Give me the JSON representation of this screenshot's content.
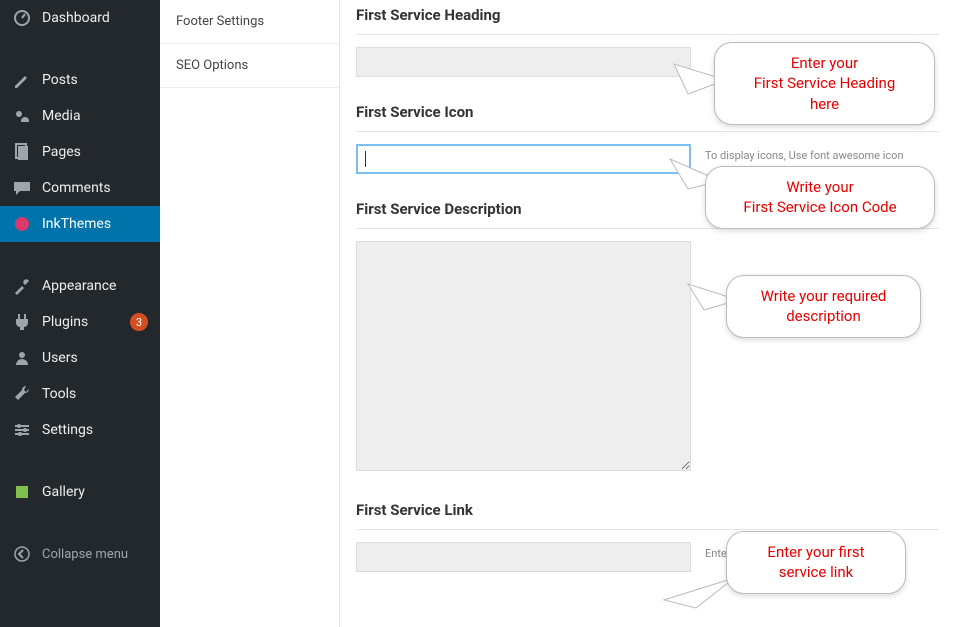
{
  "sidebar": {
    "items": [
      {
        "label": "Dashboard",
        "icon": "dashboard-icon"
      },
      {
        "label": "Posts",
        "icon": "posts-icon"
      },
      {
        "label": "Media",
        "icon": "media-icon"
      },
      {
        "label": "Pages",
        "icon": "pages-icon"
      },
      {
        "label": "Comments",
        "icon": "comments-icon"
      },
      {
        "label": "InkThemes",
        "icon": "inkthemes-icon",
        "active": true
      },
      {
        "label": "Appearance",
        "icon": "appearance-icon"
      },
      {
        "label": "Plugins",
        "icon": "plugins-icon",
        "badge": "3"
      },
      {
        "label": "Users",
        "icon": "users-icon"
      },
      {
        "label": "Tools",
        "icon": "tools-icon"
      },
      {
        "label": "Settings",
        "icon": "settings-icon"
      },
      {
        "label": "Gallery",
        "icon": "gallery-icon"
      },
      {
        "label": "Collapse menu",
        "icon": "collapse-icon"
      }
    ]
  },
  "options_column": {
    "items": [
      {
        "label": "Footer Settings"
      },
      {
        "label": "SEO Options"
      }
    ]
  },
  "main": {
    "fields": {
      "heading": {
        "label": "First Service Heading",
        "value": ""
      },
      "icon": {
        "label": "First Service Icon",
        "value": "",
        "hint": "To display icons, Use font awesome icon"
      },
      "description": {
        "label": "First Service Description",
        "value": ""
      },
      "link": {
        "label": "First Service Link",
        "value": "",
        "hint": "Enter your first service link."
      }
    }
  },
  "callouts": {
    "c1": "Enter your\nFirst Service Heading\nhere",
    "c2": "Write your\nFirst Service Icon Code",
    "c3": "Write your required\ndescription",
    "c4": "Enter your first\nservice link"
  }
}
